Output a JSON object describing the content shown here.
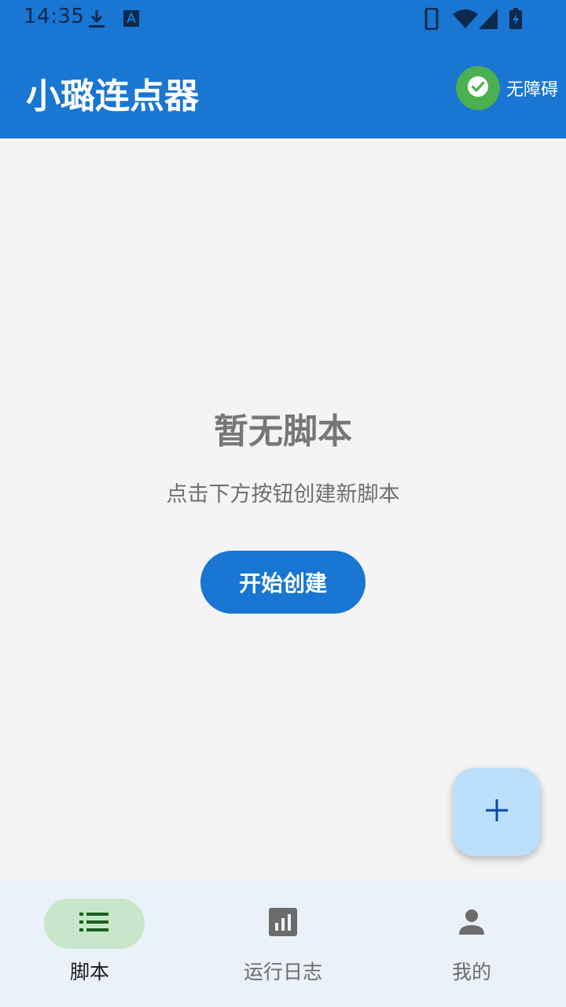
{
  "status_bar": {
    "time": "14:35",
    "icons": [
      "download-icon",
      "text-a-icon",
      "phone-icon",
      "wifi-icon",
      "signal-icon",
      "battery-charging-icon"
    ]
  },
  "app_bar": {
    "title": "小璐连点器",
    "accessibility_label": "无障碍",
    "accessibility_icon": "check-circle-icon"
  },
  "empty_state": {
    "title": "暂无脚本",
    "subtitle": "点击下方按钮创建新脚本",
    "button_label": "开始创建"
  },
  "fab": {
    "icon": "plus-icon"
  },
  "bottom_nav": {
    "items": [
      {
        "label": "脚本",
        "icon": "list-icon",
        "active": true
      },
      {
        "label": "运行日志",
        "icon": "bar-chart-icon",
        "active": false
      },
      {
        "label": "我的",
        "icon": "person-icon",
        "active": false
      }
    ]
  },
  "colors": {
    "primary": "#1976d2",
    "background": "#f4f4f4",
    "accessibility_badge": "#4caf50",
    "fab": "#bbdefb",
    "active_nav_pill": "#c8e6c9",
    "active_nav_icon": "#1b5e20"
  }
}
